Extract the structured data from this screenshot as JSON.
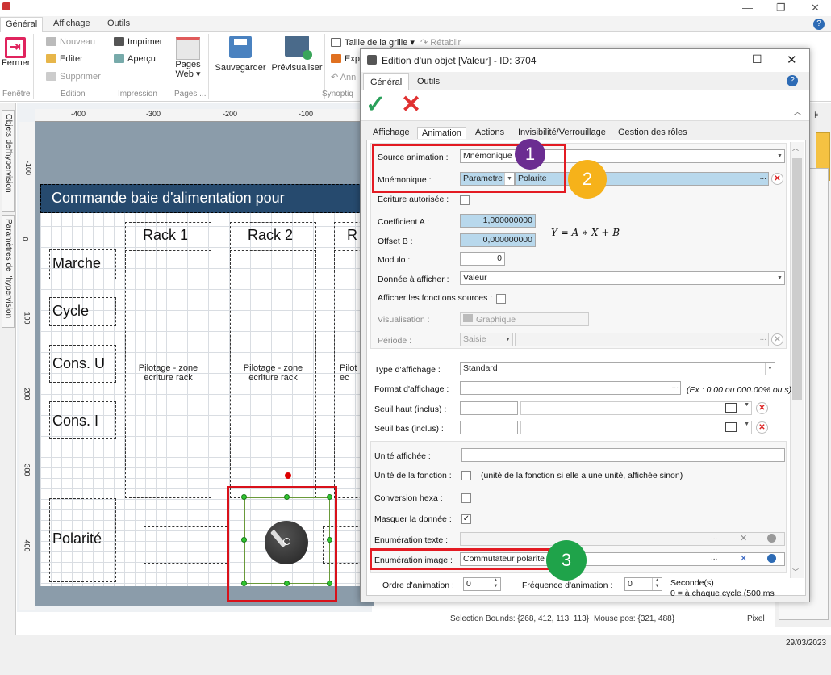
{
  "ribbon": {
    "tabs": [
      "Général",
      "Affichage",
      "Outils"
    ],
    "fenetre": {
      "close_label": "Fermer",
      "group": "Fenêtre"
    },
    "edition": {
      "new": "Nouveau",
      "edit": "Editer",
      "delete": "Supprimer",
      "group": "Edition"
    },
    "impression": {
      "print": "Imprimer",
      "preview": "Aperçu",
      "group": "Impression"
    },
    "pages": {
      "label_1": "Pages",
      "label_2": "Web ▾",
      "group": "Pages ..."
    },
    "save": "Sauvegarder",
    "preview": "Prévisualiser",
    "synoptique": {
      "grid_size": "Taille de la grille ▾",
      "redo": "Rétablir",
      "export": "Exp",
      "cancel": "Ann",
      "group": "Synoptiq"
    }
  },
  "left_tabs": [
    "Objets del'hypervision",
    "Paramètres de l'hypervision"
  ],
  "ruler": {
    "h": [
      "-400",
      "-300",
      "-200",
      "-100"
    ],
    "v": [
      "-100",
      "0",
      "100",
      "200",
      "300",
      "400"
    ]
  },
  "canvas": {
    "banner": "Commande baie d'alimentation pour",
    "racks": [
      "Rack 1",
      "Rack 2",
      "R"
    ],
    "rows": [
      "Marche",
      "Cycle",
      "Cons. U",
      "Cons. I",
      "Polarité"
    ],
    "zone_text_1": "Pilotage - zone",
    "zone_text_2": "ecriture rack",
    "zone_text_3": "Pilot",
    "zone_text_4": "ec"
  },
  "status": {
    "selection": "Selection Bounds: {268, 412, 113, 113}",
    "mouse": "Mouse pos: {321, 488}",
    "unit": "Pixel",
    "date": "29/03/2023"
  },
  "dialog": {
    "title": "Edition d'un objet [Valeur] - ID: 3704",
    "top_tabs": [
      "Général",
      "Outils"
    ],
    "sub_tabs": [
      "Affichage",
      "Animation",
      "Actions",
      "Invisibilité/Verrouillage",
      "Gestion des rôles"
    ],
    "source_animation": {
      "label": "Source animation :",
      "value": "Mnémonique"
    },
    "mnemonique": {
      "label": "Mnémonique :",
      "param": "Parametre",
      "value": "Polarite"
    },
    "ecriture_autorisee": {
      "label": "Ecriture autorisée :",
      "checked": false
    },
    "coef_a": {
      "label": "Coefficient A :",
      "value": "1,000000000"
    },
    "offset_b": {
      "label": "Offset B :",
      "value": "0,000000000"
    },
    "formula": "Y = A ∗ X + B",
    "modulo": {
      "label": "Modulo :",
      "value": "0"
    },
    "donnee": {
      "label": "Donnée à afficher :",
      "value": "Valeur"
    },
    "afficher_sources": {
      "label": "Afficher les fonctions sources :"
    },
    "visualisation": {
      "label": "Visualisation :",
      "value": "Graphique"
    },
    "periode": {
      "label": "Période :",
      "value": "Saisie"
    },
    "type_affichage": {
      "label": "Type d'affichage :",
      "value": "Standard"
    },
    "format_affichage": {
      "label": "Format d'affichage :",
      "hint": "(Ex : 0.00 ou 000.00% ou s)"
    },
    "seuil_haut": {
      "label": "Seuil haut (inclus) :"
    },
    "seuil_bas": {
      "label": "Seuil bas (inclus) :"
    },
    "unite_affichee": {
      "label": "Unité affichée :"
    },
    "unite_fonction": {
      "label": "Unité de la fonction :",
      "hint": "(unité de la fonction si elle a une unité, affichée sinon)"
    },
    "conversion_hexa": {
      "label": "Conversion hexa :"
    },
    "masquer": {
      "label": "Masquer la donnée :",
      "checked_mark": "✓"
    },
    "enum_texte": {
      "label": "Enumération texte :"
    },
    "enum_image": {
      "label": "Enumération image :",
      "value": "Commutateur polarite"
    },
    "ordre": {
      "label": "Ordre d'animation :",
      "value": "0"
    },
    "frequence": {
      "label": "Fréquence d'animation :",
      "value": "0",
      "unit": "Seconde(s)",
      "note": "0 = à chaque cycle (500 ms"
    },
    "ellipsis": "...",
    "badges": [
      "1",
      "2",
      "3"
    ]
  },
  "colors": {
    "badge1": "#6b2d91",
    "badge2": "#f6b21a",
    "badge3": "#1fa34a",
    "highlight": "#e31b23",
    "banner": "#264a6e"
  }
}
